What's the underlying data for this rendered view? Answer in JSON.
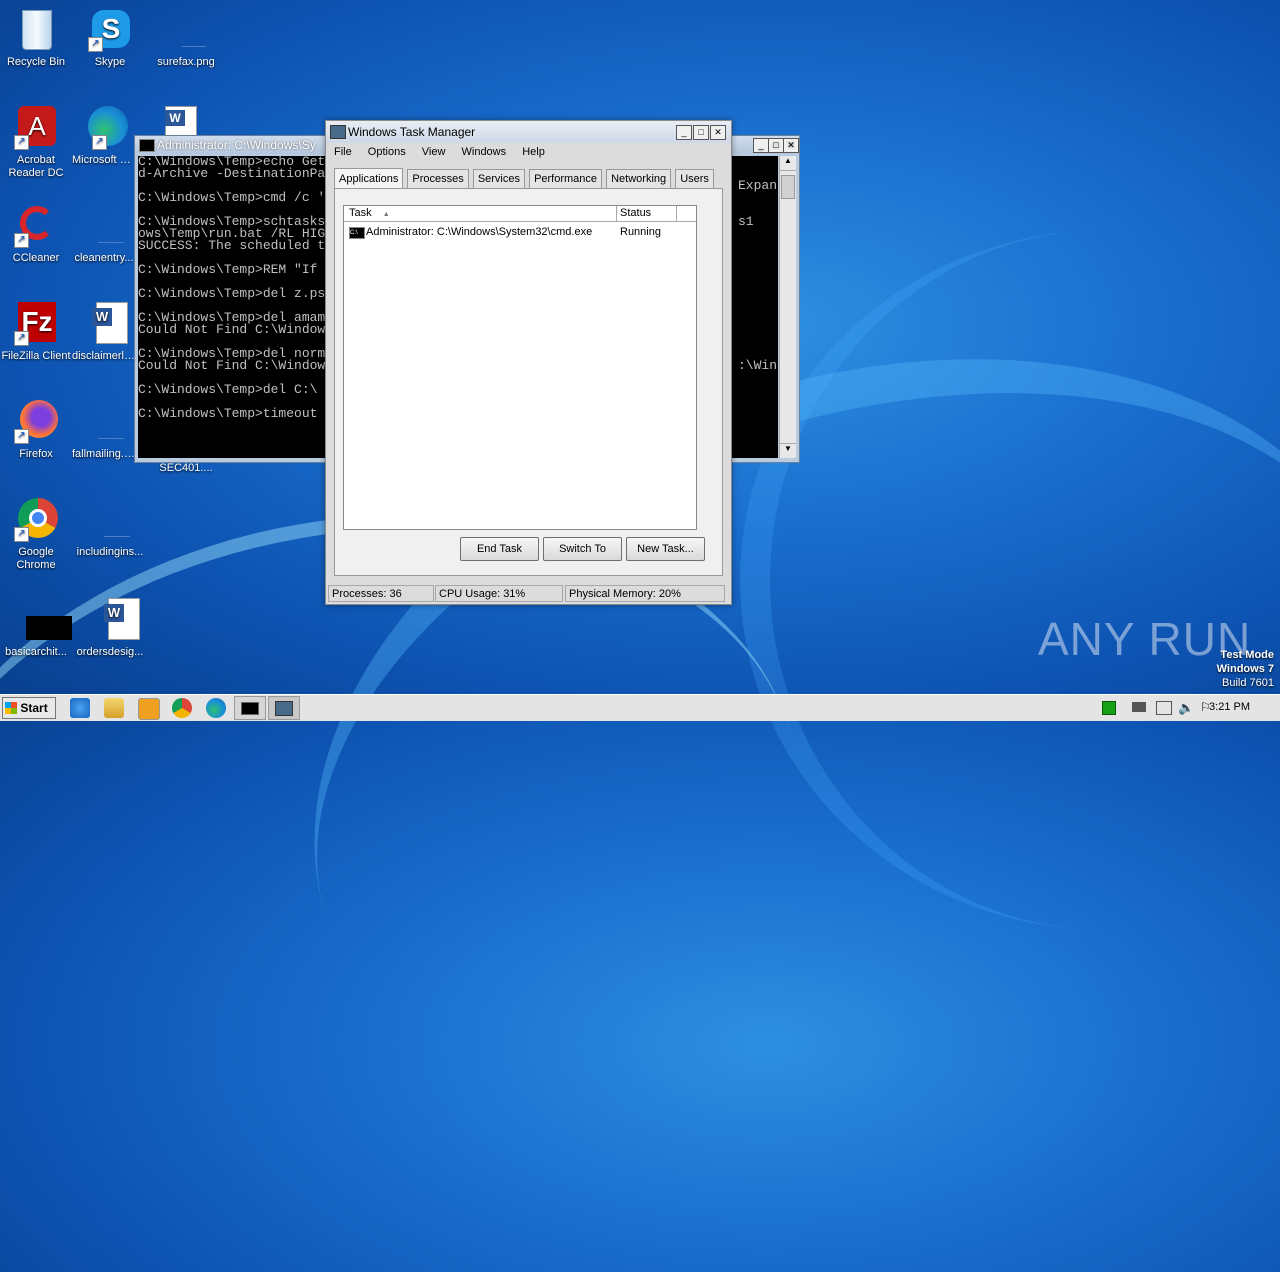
{
  "desktop": {
    "icons": [
      {
        "label": "Recycle Bin"
      },
      {
        "label": "Skype"
      },
      {
        "label": "surefax.png"
      },
      {
        "label": "Acrobat Reader DC"
      },
      {
        "label": "Microsoft Edge"
      },
      {
        "label": "CCleaner"
      },
      {
        "label": "cleanentry..."
      },
      {
        "label": "FileZilla Client"
      },
      {
        "label": "disclaimerlive"
      },
      {
        "label": "Firefox"
      },
      {
        "label": "fallmailing.p..."
      },
      {
        "label": "SEC401...."
      },
      {
        "label": "Google Chrome"
      },
      {
        "label": "includingins..."
      },
      {
        "label": "basicarchit..."
      },
      {
        "label": "ordersdesig..."
      }
    ]
  },
  "console": {
    "title": "Administrator: C:\\Windows\\Sy",
    "lines": [
      "C:\\Windows\\Temp>echo Get",
      "d-Archive -DestinationPa",
      "",
      "C:\\Windows\\Temp>cmd /c '",
      "",
      "C:\\Windows\\Temp>schtasks",
      "ows\\Temp\\run.bat /RL HIG",
      "SUCCESS: The scheduled t",
      "",
      "C:\\Windows\\Temp>REM \"If",
      "",
      "C:\\Windows\\Temp>del z.ps",
      "",
      "C:\\Windows\\Temp>del amam",
      "Could Not Find C:\\Window",
      "",
      "C:\\Windows\\Temp>del norm",
      "Could Not Find C:\\Window",
      "",
      "C:\\Windows\\Temp>del C:\\",
      "",
      "C:\\Windows\\Temp>timeout"
    ],
    "right_lines": [
      "Expan",
      "s1",
      "",
      "",
      "",
      ":\\Wind"
    ]
  },
  "taskmanager": {
    "title": "Windows Task Manager",
    "menu": [
      "File",
      "Options",
      "View",
      "Windows",
      "Help"
    ],
    "tabs": [
      "Applications",
      "Processes",
      "Services",
      "Performance",
      "Networking",
      "Users"
    ],
    "columns": {
      "task": "Task",
      "status": "Status"
    },
    "rows": [
      {
        "task": "Administrator: C:\\Windows\\System32\\cmd.exe",
        "status": "Running"
      }
    ],
    "buttons": {
      "end": "End Task",
      "switch": "Switch To",
      "new": "New Task..."
    },
    "status": {
      "processes": "Processes: 36",
      "cpu": "CPU Usage: 31%",
      "memory": "Physical Memory: 20%"
    }
  },
  "watermark": {
    "text": "ANY RUN"
  },
  "testmode": {
    "line1": "Test Mode",
    "line2": "Windows 7",
    "line3": "Build 7601"
  },
  "taskbar": {
    "start": "Start",
    "clock": "3:21 PM"
  }
}
